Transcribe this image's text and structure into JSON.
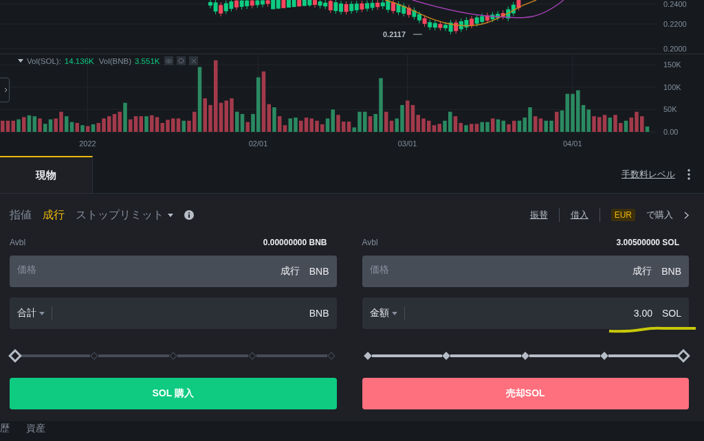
{
  "price_chart": {
    "axis_labels": [
      "0.2400",
      "0.2200",
      "0.2000"
    ],
    "low_label": "0.2117"
  },
  "volume_chart": {
    "legend": [
      {
        "label": "Vol(SOL):",
        "value": "14.136K"
      },
      {
        "label": "Vol(BNB)",
        "value": "3.551K"
      }
    ],
    "date_labels": [
      "2022",
      "02/01",
      "03/01",
      "04/01"
    ],
    "chart_data": {
      "type": "bar",
      "stacked": true,
      "grid": true,
      "ylim": [
        0,
        175
      ],
      "yticks": [
        {
          "value": 0,
          "label": "0.00"
        },
        {
          "value": 50,
          "label": "50K"
        },
        {
          "value": 100,
          "label": "100K"
        },
        {
          "value": 150,
          "label": "150K"
        }
      ],
      "series": [
        {
          "color": "#2b8a62",
          "values": [
            null,
            null,
            null,
            28,
            null,
            37,
            35,
            null,
            18,
            28,
            null,
            null,
            35,
            22,
            null,
            15,
            null,
            17,
            null,
            null,
            null,
            null,
            null,
            65,
            null,
            null,
            null,
            35,
            null,
            null,
            null,
            null,
            null,
            null,
            25,
            null,
            null,
            145,
            null,
            null,
            null,
            null,
            null,
            null,
            45,
            40,
            null,
            40,
            122,
            null,
            null,
            55,
            null,
            null,
            30,
            32,
            null,
            null,
            null,
            null,
            null,
            30,
            50,
            null,
            null,
            null,
            10,
            45,
            45,
            null,
            40,
            120,
            null,
            null,
            30,
            60,
            null,
            null,
            null,
            null,
            null,
            null,
            null,
            25,
            45,
            null,
            null,
            15,
            null,
            null,
            22,
            22,
            null,
            28,
            25,
            null,
            null,
            25,
            32,
            55,
            null,
            null,
            25,
            25,
            null,
            48,
            85,
            85,
            93,
            60,
            50,
            null,
            null,
            null,
            32,
            null,
            null,
            25,
            null,
            null,
            null,
            12
          ]
        },
        {
          "color": "#a33a4b",
          "values": [
            25,
            25,
            25,
            null,
            33,
            null,
            null,
            30,
            null,
            null,
            30,
            45,
            null,
            null,
            20,
            null,
            13,
            null,
            20,
            30,
            35,
            40,
            45,
            null,
            28,
            35,
            35,
            null,
            37,
            33,
            20,
            27,
            30,
            30,
            null,
            25,
            45,
            null,
            75,
            60,
            160,
            65,
            70,
            75,
            null,
            null,
            22,
            null,
            null,
            135,
            62,
            null,
            35,
            15,
            null,
            null,
            25,
            32,
            30,
            25,
            17,
            null,
            null,
            38,
            23,
            23,
            null,
            null,
            null,
            35,
            null,
            null,
            45,
            25,
            null,
            null,
            70,
            60,
            38,
            30,
            25,
            15,
            18,
            null,
            null,
            35,
            20,
            null,
            18,
            18,
            null,
            null,
            30,
            null,
            null,
            17,
            25,
            null,
            null,
            null,
            35,
            30,
            null,
            null,
            45,
            null,
            null,
            null,
            null,
            null,
            null,
            35,
            33,
            38,
            null,
            38,
            20,
            null,
            32,
            45,
            35,
            null
          ]
        }
      ]
    }
  },
  "tabs": [
    {
      "label": "現物",
      "selected": true
    }
  ],
  "fee_link": "手数料レベル",
  "order_types": [
    {
      "label": "指値",
      "selected": false
    },
    {
      "label": "成行",
      "selected": true
    },
    {
      "label": "ストップリミット",
      "selected": false,
      "dropdown": true
    }
  ],
  "links": [
    "振替",
    "借入"
  ],
  "buy_with": {
    "currency": "EUR",
    "label": "で購入"
  },
  "forms": [
    {
      "avbl_label": "Avbl",
      "avbl_value": "0.00000000 BNB",
      "price": {
        "placeholder": "価格",
        "value": "成行",
        "unit": "BNB",
        "disabled": true
      },
      "amount": {
        "label": "合計",
        "unit": "BNB"
      },
      "slider": {
        "level": 0
      },
      "button": {
        "label": "SOL 購入",
        "kind": "buy"
      }
    },
    {
      "avbl_label": "Avbl",
      "avbl_value": "3.00500000 SOL",
      "price": {
        "placeholder": "価格",
        "value": "成行",
        "unit": "BNB",
        "disabled": true
      },
      "amount": {
        "label": "金額",
        "value": "3.00",
        "unit": "SOL",
        "underlined": true
      },
      "slider": {
        "level": 1
      },
      "button": {
        "label": "売却SOL",
        "kind": "sell"
      }
    }
  ],
  "bottom_tabs": [
    "歴",
    "資産"
  ]
}
